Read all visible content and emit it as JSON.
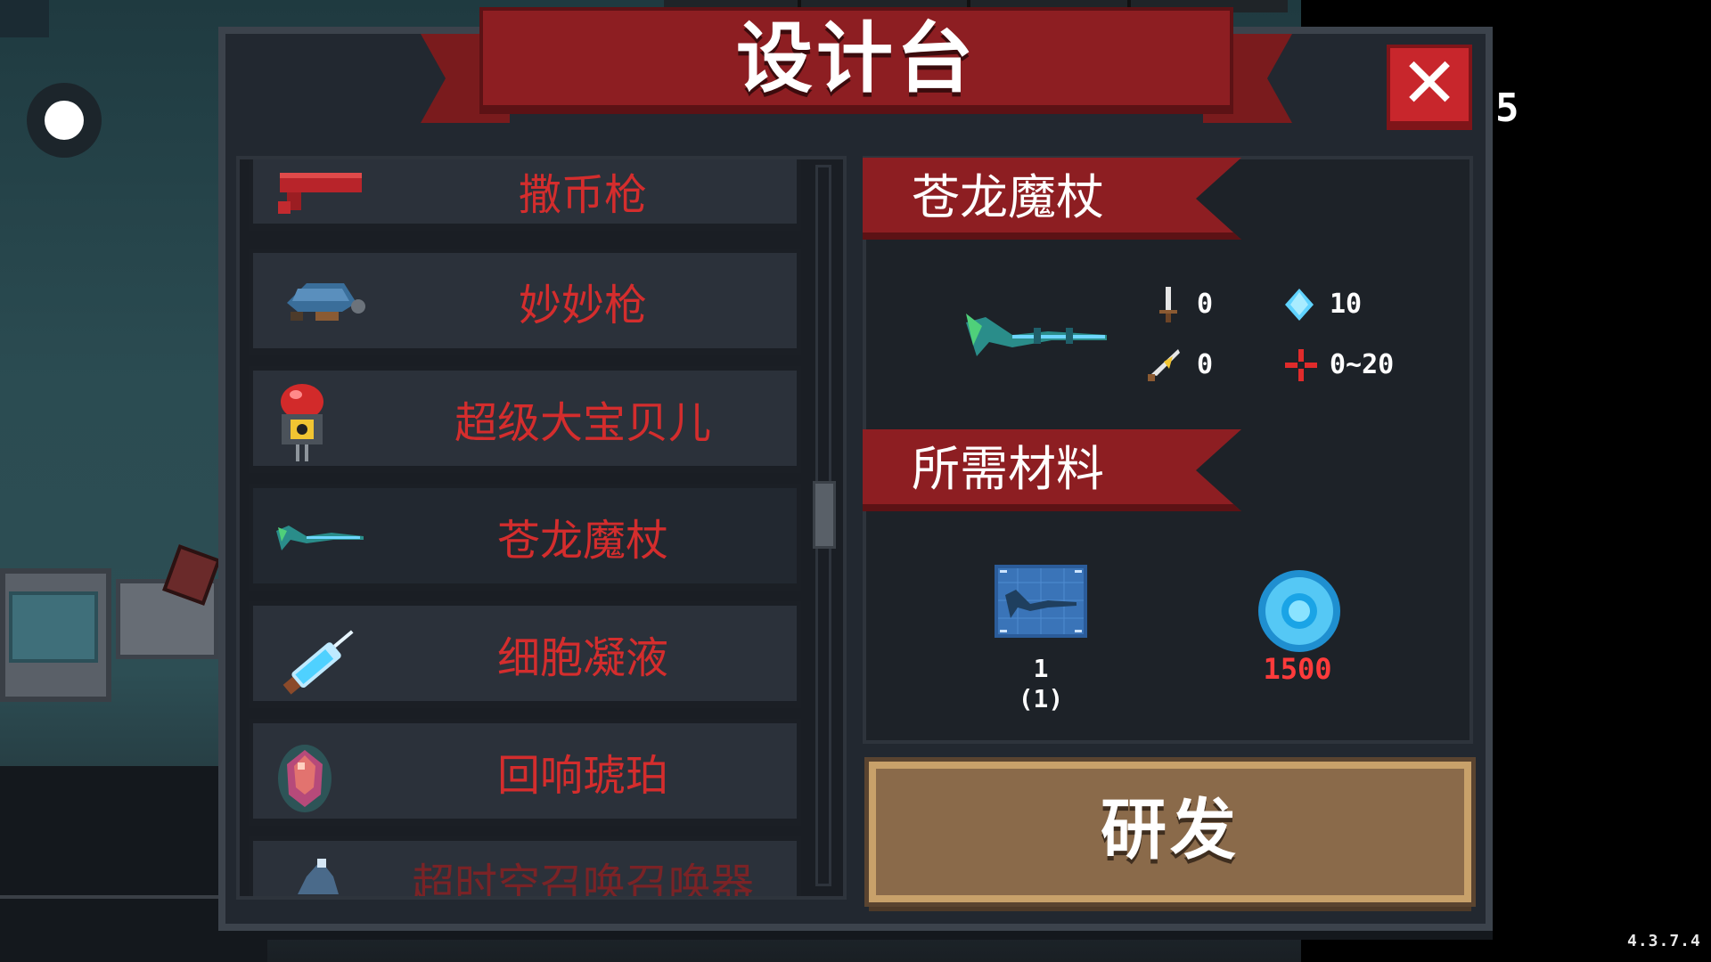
{
  "dialog": {
    "title": "设计台",
    "close_label": "✕"
  },
  "list": {
    "items": [
      {
        "label": "撒币枪",
        "icon": "coin-gun-icon"
      },
      {
        "label": "妙妙枪",
        "icon": "turtle-gun-icon"
      },
      {
        "label": "超级大宝贝儿",
        "icon": "nuke-bomb-icon"
      },
      {
        "label": "苍龙魔杖",
        "icon": "dragon-staff-icon",
        "selected": true
      },
      {
        "label": "细胞凝液",
        "icon": "syringe-icon"
      },
      {
        "label": "回响琥珀",
        "icon": "amber-gem-icon"
      },
      {
        "label": "超时空召唤召唤器",
        "icon": "summoner-icon"
      }
    ]
  },
  "detail": {
    "name": "苍龙魔杖",
    "stats": {
      "damage": "0",
      "energy": "10",
      "crit": "0",
      "spread": "0~20"
    },
    "materials_title": "所需材料",
    "materials": {
      "blueprint_count": "1",
      "blueprint_owned": "(1)",
      "gem_cost": "1500"
    },
    "develop_label": "研发"
  },
  "hud": {
    "version": "4.3.7.4",
    "side_digit": "5"
  },
  "colors": {
    "banner_red": "#8d1e22",
    "label_red": "#d42d2d",
    "cost_red": "#ff3b3b",
    "panel_dark": "#222830",
    "button_brown": "#8a6a4a"
  }
}
